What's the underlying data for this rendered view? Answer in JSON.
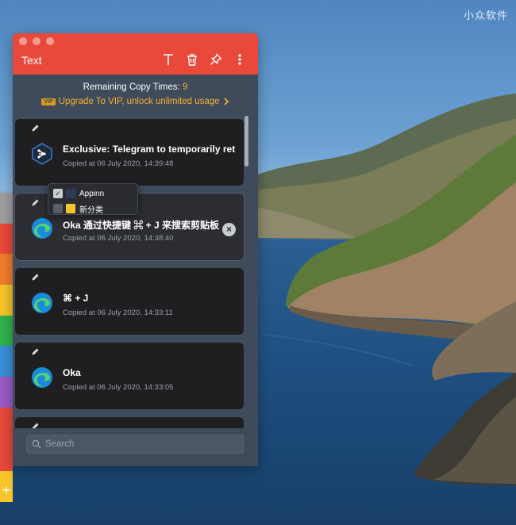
{
  "desktop": {
    "watermark": "小众软件"
  },
  "strip_colors": [
    "#9e9f9e",
    "#e9493b",
    "#ef7c2a",
    "#f5c52a",
    "#2fb24b",
    "#3a8fd9",
    "#9a5bc4",
    "#e9493b",
    "#f5c52a"
  ],
  "window": {
    "title": "Text",
    "toolbar_icons": [
      "text-format-icon",
      "trash-icon",
      "pin-icon",
      "more-icon"
    ]
  },
  "quota": {
    "label": "Remaining Copy Times:",
    "count": "9",
    "vip_badge": "VIP",
    "vip_text": "Upgrade To VIP, unlock unlimited usage"
  },
  "clips": [
    {
      "title": "Exclusive: Telegram to temporarily ret",
      "time": "Copied at 06 July 2020, 14:39:48",
      "icon": "git-app-icon"
    },
    {
      "title": "Oka 通过快捷键 ⌘ + J 来搜索剪贴板",
      "time": "Copied at 06 July 2020, 14:38:40",
      "icon": "edge-icon"
    },
    {
      "title": "⌘ + J",
      "time": "Copied at 06 July 2020, 14:33:11",
      "icon": "edge-icon"
    },
    {
      "title": "Oka",
      "time": "Copied at 06 July 2020, 14:33:05",
      "icon": "edge-icon"
    }
  ],
  "popover": {
    "items": [
      {
        "label": "Appinn",
        "checked": true,
        "color": "#2f3a55"
      },
      {
        "label": "新分类",
        "checked": false,
        "color": "#f5c52a"
      }
    ]
  },
  "search": {
    "placeholder": "Search"
  },
  "colors": {
    "accent": "#e9493b",
    "highlight": "#f2b233",
    "panel": "#3f4a5a",
    "card": "#1f1f21"
  }
}
